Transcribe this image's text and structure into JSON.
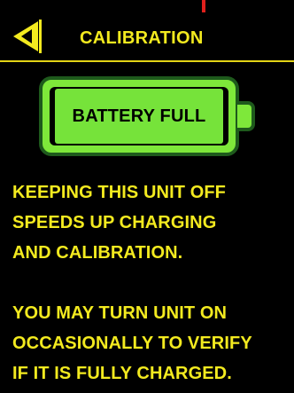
{
  "colors": {
    "background": "#000000",
    "text": "#f3ea1f",
    "divider": "#e3d316",
    "battery_green": "#76e33a",
    "battery_outline": "#1e5a1c",
    "top_marker": "#e0201c"
  },
  "header": {
    "back_icon": "back-triangle-icon",
    "title": "CALIBRATION"
  },
  "battery": {
    "icon": "battery-full-icon",
    "label": "BATTERY FULL",
    "charge_fraction": 1.0
  },
  "messages": [
    {
      "lines": [
        "KEEPING THIS UNIT OFF",
        "SPEEDS UP CHARGING",
        "AND CALIBRATION."
      ]
    },
    {
      "lines": [
        "YOU MAY TURN UNIT ON",
        "OCCASIONALLY TO VERIFY",
        "IF IT IS FULLY CHARGED."
      ]
    }
  ]
}
